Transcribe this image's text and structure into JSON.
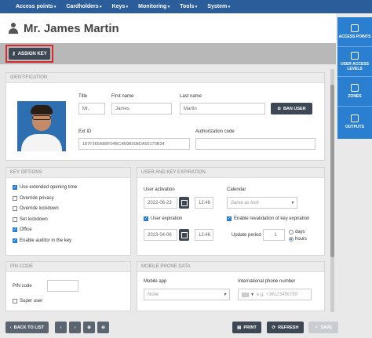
{
  "nav": {
    "items": [
      "Access points",
      "Cardholders",
      "Keys",
      "Monitoring",
      "Tools",
      "System"
    ]
  },
  "header": {
    "title": "Mr. James Martin"
  },
  "toolbar": {
    "assign_key": "ASSIGN KEY"
  },
  "sidebar": {
    "items": [
      "ACCESS POINTS",
      "USER ACCESS LEVELS",
      "ZONES",
      "OUTPUTS"
    ]
  },
  "identification": {
    "heading": "IDENTIFICATION",
    "title_label": "Title",
    "title_value": "Mr.",
    "first_label": "First name",
    "first_value": "James",
    "last_label": "Last name",
    "last_value": "Martin",
    "ban_button": "BAN USER",
    "extid_label": "Ext ID",
    "extid_value": "187F365AB8F04BC4B9B008DA55170B34",
    "auth_label": "Authorization code",
    "auth_value": ""
  },
  "key_options": {
    "heading": "KEY OPTIONS",
    "items": [
      {
        "label": "Use extended opening time",
        "checked": true
      },
      {
        "label": "Override privacy",
        "checked": false
      },
      {
        "label": "Override lockdown",
        "checked": false
      },
      {
        "label": "Set lockdown",
        "checked": false
      },
      {
        "label": "Office",
        "checked": true
      },
      {
        "label": "Enable auditor in the key",
        "checked": true
      }
    ]
  },
  "expiration": {
    "heading": "USER AND KEY EXPIRATION",
    "activation_label": "User activation",
    "activation_date": "2022-06-23",
    "activation_time": "12:46",
    "calendar_label": "Calendar",
    "calendar_value": "Same as lock",
    "expiration_check": "User expiration",
    "expiration_date": "2023-04-06",
    "expiration_time": "12:46",
    "revalidation_check": "Enable revalidation of key expiration",
    "update_label": "Update period",
    "update_value": "1",
    "unit_days": "days",
    "unit_hours": "hours"
  },
  "pin": {
    "heading": "PIN CODE",
    "pin_label": "PIN code",
    "super_user": "Super user"
  },
  "mobile": {
    "heading": "MOBILE PHONE DATA",
    "app_label": "Mobile app",
    "app_value": "None",
    "phone_label": "International phone number",
    "phone_placeholder": "e.g. +34123456789"
  },
  "footer": {
    "back": "BACK TO LIST",
    "print": "PRINT",
    "refresh": "REFRESH",
    "save": "SAVE"
  }
}
